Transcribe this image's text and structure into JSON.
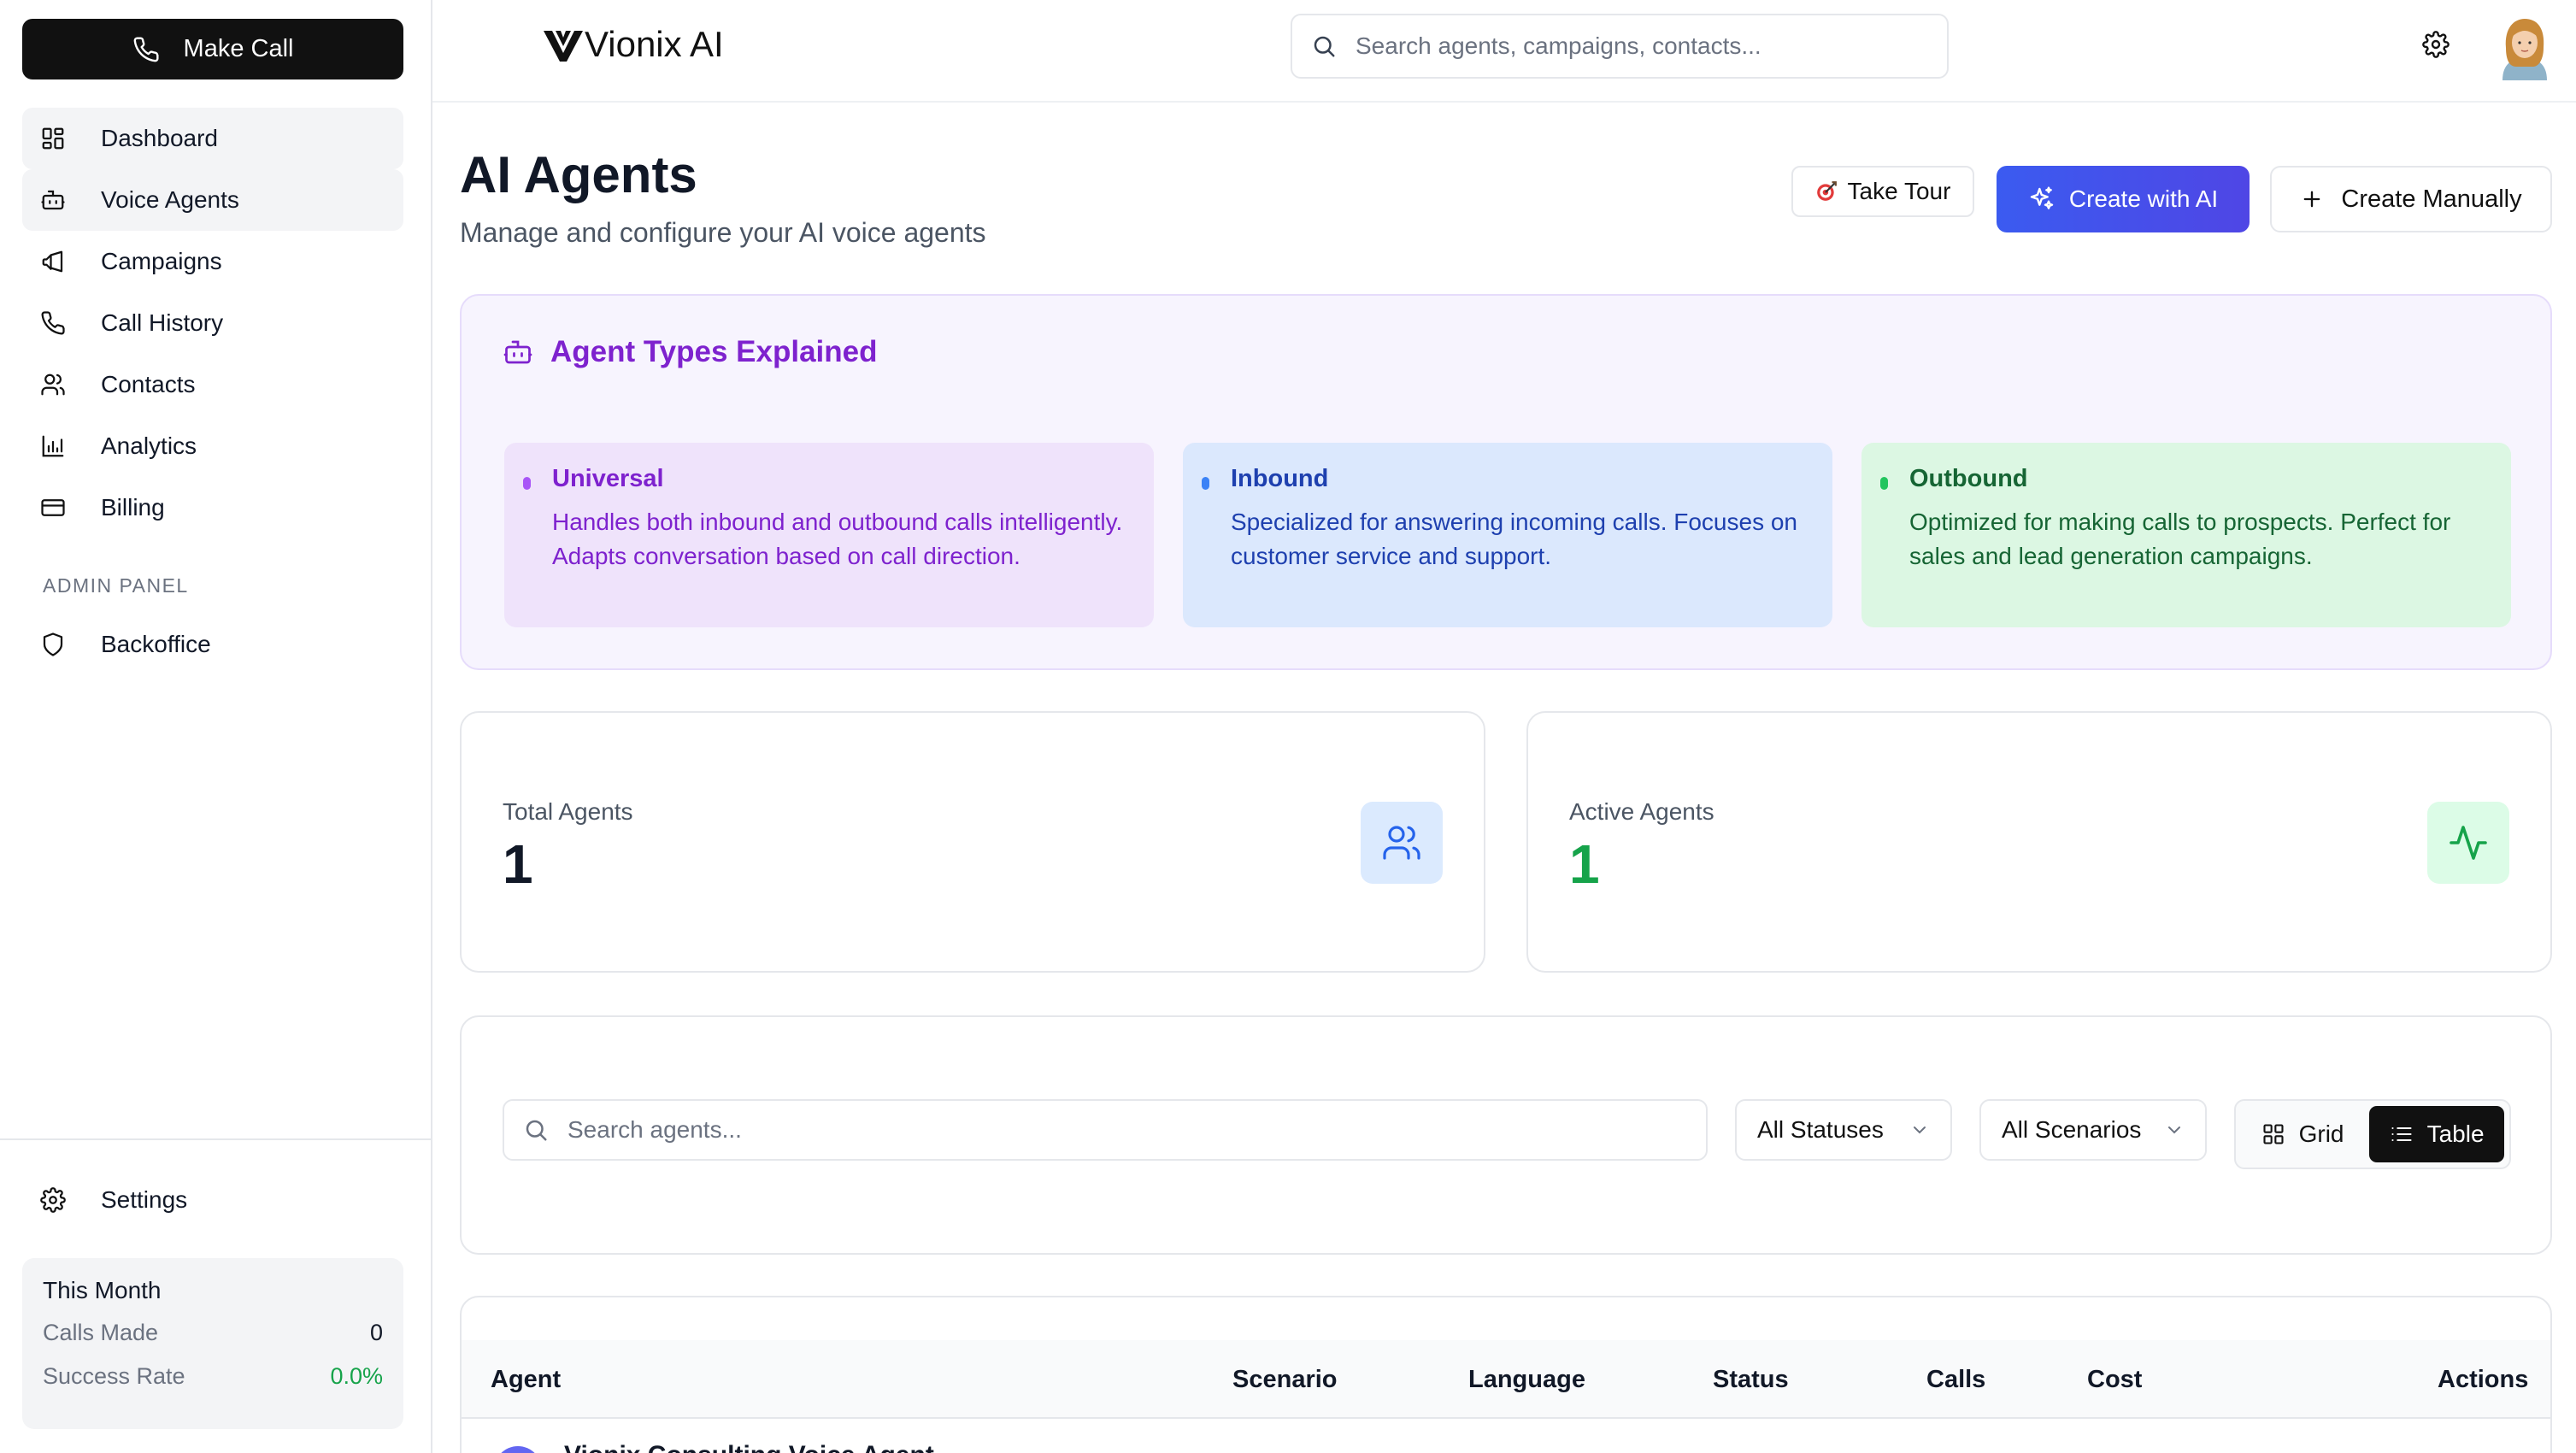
{
  "sidebar": {
    "make_call_label": "Make Call",
    "items": [
      {
        "label": "Dashboard"
      },
      {
        "label": "Voice Agents"
      },
      {
        "label": "Campaigns"
      },
      {
        "label": "Call History"
      },
      {
        "label": "Contacts"
      },
      {
        "label": "Analytics"
      },
      {
        "label": "Billing"
      }
    ],
    "admin_label": "ADMIN PANEL",
    "admin_items": [
      {
        "label": "Backoffice"
      }
    ],
    "settings_label": "Settings",
    "month": {
      "title": "This Month",
      "calls_label": "Calls Made",
      "calls_value": "0",
      "success_label": "Success Rate",
      "success_value": "0.0%"
    }
  },
  "header": {
    "brand": "Vionix AI",
    "search_placeholder": "Search agents, campaigns, contacts..."
  },
  "page": {
    "title": "AI Agents",
    "subtitle": "Manage and configure your AI voice agents",
    "tour_label": "Take Tour",
    "create_ai_label": "Create with AI",
    "create_manual_label": "Create Manually"
  },
  "agent_types": {
    "title": "Agent Types Explained",
    "types": [
      {
        "name": "Universal",
        "desc": "Handles both inbound and outbound calls intelligently. Adapts conversation based on call direction.",
        "color": "#7e22ce"
      },
      {
        "name": "Inbound",
        "desc": "Specialized for answering incoming calls. Focuses on customer service and support.",
        "color": "#1e40af"
      },
      {
        "name": "Outbound",
        "desc": "Optimized for making calls to prospects. Perfect for sales and lead generation campaigns.",
        "color": "#166534"
      }
    ]
  },
  "stats": {
    "total_label": "Total Agents",
    "total_value": "1",
    "active_label": "Active Agents",
    "active_value": "1"
  },
  "filters": {
    "search_placeholder": "Search agents...",
    "status_value": "All Statuses",
    "scenario_value": "All Scenarios",
    "grid_label": "Grid",
    "table_label": "Table",
    "active_view": "Table"
  },
  "table": {
    "columns": [
      "Agent",
      "Scenario",
      "Language",
      "Status",
      "Calls",
      "Cost",
      "Actions"
    ],
    "rows": [
      {
        "agent": "Vionix Consulting Voice Agent"
      }
    ]
  },
  "colors": {
    "primary": "#4f46e5",
    "success": "#16a34a",
    "dark_button": "#111111"
  }
}
